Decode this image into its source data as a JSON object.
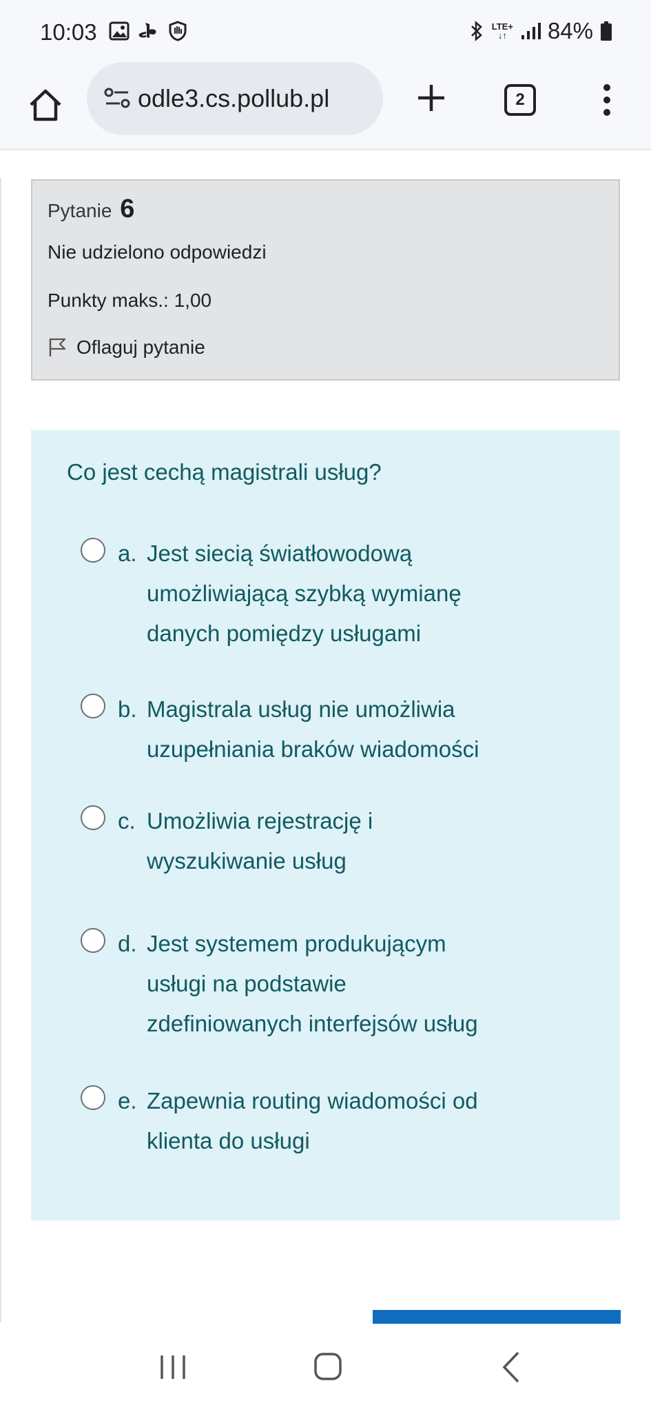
{
  "status": {
    "time": "10:03",
    "network": "LTE+",
    "battery": "84%"
  },
  "browser": {
    "url": "odle3.cs.pollub.pl",
    "tab_count": "2"
  },
  "question_info": {
    "label": "Pytanie",
    "number": "6",
    "state": "Nie udzielono odpowiedzi",
    "points": "Punkty maks.: 1,00",
    "flag_label": "Oflaguj pytanie"
  },
  "question": {
    "text": "Co jest cechą magistrali usług?",
    "answers": [
      {
        "letter": "a.",
        "lines": [
          "Jest siecią światłowodową",
          "umożliwiającą szybką wymianę",
          "danych pomiędzy usługami"
        ]
      },
      {
        "letter": "b.",
        "lines": [
          "Magistrala usług nie umożliwia",
          "uzupełniania braków wiadomości"
        ]
      },
      {
        "letter": "c.",
        "lines": [
          "Umożliwia rejestrację i",
          "wyszukiwanie usług"
        ]
      },
      {
        "letter": "d.",
        "lines": [
          "Jest systemem produkującym",
          "usługi na podstawie",
          "zdefiniowanych interfejsów usług"
        ]
      },
      {
        "letter": "e.",
        "lines": [
          "Zapewnia routing wiadomości od",
          "klienta do usługi"
        ]
      }
    ]
  },
  "colors": {
    "accent": "#0f6cbf",
    "answer_text": "#115a5f",
    "formulation_bg": "#def2f8",
    "info_bg": "#e2e4e6"
  }
}
